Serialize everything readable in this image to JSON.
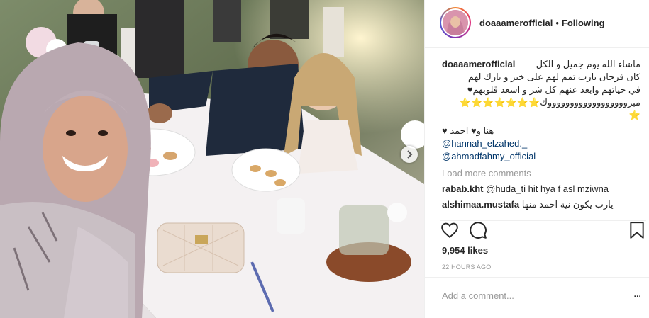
{
  "post": {
    "author_username": "doaaamerofficial",
    "separator": "•",
    "follow_status": "Following",
    "caption_lines": [
      "ماشاء الله يوم جميل و الكل",
      "كان فرحان يارب تمم لهم على خير و بارك لهم",
      "في حياتهم وابعد عنهم كل شر و اسعد قلوبهم♥",
      "مبرووووووووووووووووووك⭐⭐⭐⭐⭐⭐⭐",
      "⭐"
    ],
    "caption_line2": "♥ هنا و♥ احمد",
    "mentions": [
      "@hannah_elzahed._",
      "@ahmadfahmy_official"
    ],
    "load_more": "Load more comments",
    "comments": [
      {
        "user": "rabab.kht",
        "text": "@huda_ti hit hya f asl mziwna"
      },
      {
        "user": "alshimaa.mustafa",
        "text": "يارب يكون نية احمد منها"
      }
    ],
    "likes": "9,954 likes",
    "timestamp": "22 HOURS AGO",
    "add_comment_placeholder": "Add a comment...",
    "more_options": "..."
  },
  "icons": {
    "like": "heart-icon",
    "comment": "comment-bubble-icon",
    "save": "bookmark-icon",
    "next": "chevron-right-icon"
  },
  "colors": {
    "link": "#003569",
    "muted": "#999999",
    "text": "#262626",
    "border": "#efefef"
  }
}
